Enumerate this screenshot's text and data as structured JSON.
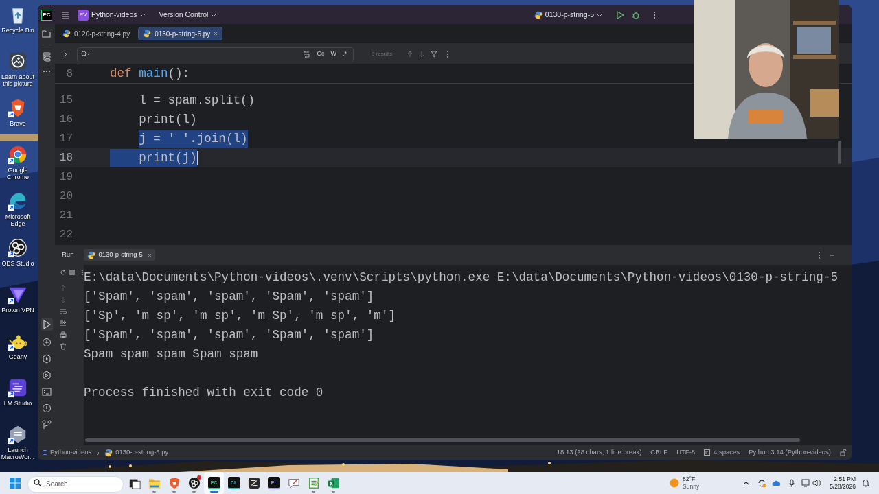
{
  "desktop_icons": [
    {
      "kind": "bin",
      "label": "Recycle Bin"
    },
    {
      "kind": "landscape",
      "label": "Learn about this picture"
    },
    {
      "kind": "shield",
      "label": "Brave"
    },
    {
      "kind": "ring",
      "label": "Google Chrome"
    },
    {
      "kind": "wave",
      "label": "Microsoft Edge"
    },
    {
      "kind": "disc",
      "label": "OBS Studio"
    },
    {
      "kind": "triangle",
      "label": "Proton VPN"
    },
    {
      "kind": "teapot",
      "label": "Geany"
    },
    {
      "kind": "window",
      "label": "LM Studio"
    },
    {
      "kind": "hexagon",
      "label": "Launch MacroWor..."
    }
  ],
  "ide": {
    "logo": "PC",
    "project": {
      "badge": "PV",
      "name": "Python-videos"
    },
    "vcs": "Version Control",
    "run_config": "0130-p-string-5",
    "tabs": [
      {
        "label": "0120-p-string-4.py",
        "selected": false
      },
      {
        "label": "0130-p-string-5.py",
        "selected": true
      }
    ],
    "search": {
      "options": [
        "Cc",
        "W",
        ".*"
      ],
      "results": "0 results"
    },
    "editor": {
      "sticky": {
        "number": "8",
        "tokens": [
          {
            "kind": "keyword",
            "text": "def"
          },
          {
            "kind": "function",
            "text": "main"
          },
          {
            "kind": "plain",
            "text": "():"
          }
        ]
      },
      "lines": [
        {
          "number": "15",
          "text": "    l = spam.split()",
          "selected": false,
          "current": false
        },
        {
          "number": "16",
          "text": "    print(l)",
          "selected": false,
          "current": false
        },
        {
          "number": "17",
          "text": "    j = ' '.join(l)",
          "selected": true,
          "current": false
        },
        {
          "number": "18",
          "text": "    print(j)",
          "selected": true,
          "current": true
        },
        {
          "number": "19",
          "current": false
        },
        {
          "number": "20",
          "current": false
        },
        {
          "number": "21",
          "current": false
        },
        {
          "number": "22",
          "current": false
        }
      ]
    },
    "run_panel": {
      "title": "Run",
      "tab": "0130-p-string-5",
      "output": [
        {
          "kind": "line",
          "text": "E:\\data\\Documents\\Python-videos\\.venv\\Scripts\\python.exe E:\\data\\Documents\\Python-videos\\0130-p-string-5"
        },
        {
          "kind": "line",
          "text": "['Spam', 'spam', 'spam', 'Spam', 'spam']"
        },
        {
          "kind": "line",
          "text": "['Sp', 'm sp', 'm sp', 'm Sp', 'm sp', 'm']"
        },
        {
          "kind": "line",
          "text": "['Spam', 'spam', 'spam', 'Spam', 'spam']"
        },
        {
          "kind": "line",
          "text": "Spam spam spam Spam spam"
        },
        {
          "kind": "exit",
          "text": "Process finished with exit code 0"
        }
      ]
    },
    "status_bar": {
      "breadcrumb": [
        "Python-videos",
        "0130-p-string-5.py"
      ],
      "items": [
        "18:13 (28 chars, 1 line break)",
        "CRLF",
        "UTF-8",
        "4 spaces",
        "Python 3.14 (Python-videos)"
      ]
    }
  },
  "taskbar": {
    "search_placeholder": "Search",
    "apps": [
      {
        "kind": "stack",
        "running": false,
        "selected": false
      },
      {
        "kind": "folder",
        "running": true,
        "selected": false
      },
      {
        "kind": "shield",
        "running": true,
        "selected": false
      },
      {
        "kind": "disc",
        "running": true,
        "selected": false,
        "badge": true
      },
      {
        "kind": "tile",
        "glyph": "PC",
        "color": "#21d789",
        "running": true,
        "selected": true
      },
      {
        "kind": "tile",
        "glyph": "CL",
        "color": "#22c3d6",
        "running": false,
        "selected": false
      },
      {
        "kind": "pen",
        "running": false,
        "selected": false
      },
      {
        "kind": "tile",
        "glyph": "Pr",
        "color": "#9999ff",
        "running": false,
        "selected": false
      },
      {
        "kind": "chat",
        "running": false,
        "selected": false
      },
      {
        "kind": "note",
        "running": true,
        "selected": false
      },
      {
        "kind": "sheet",
        "running": true,
        "selected": false
      }
    ],
    "weather": {
      "temp": "82°F",
      "condition": "Sunny"
    },
    "time": "2:51 PM",
    "date": "5/28/2026"
  }
}
